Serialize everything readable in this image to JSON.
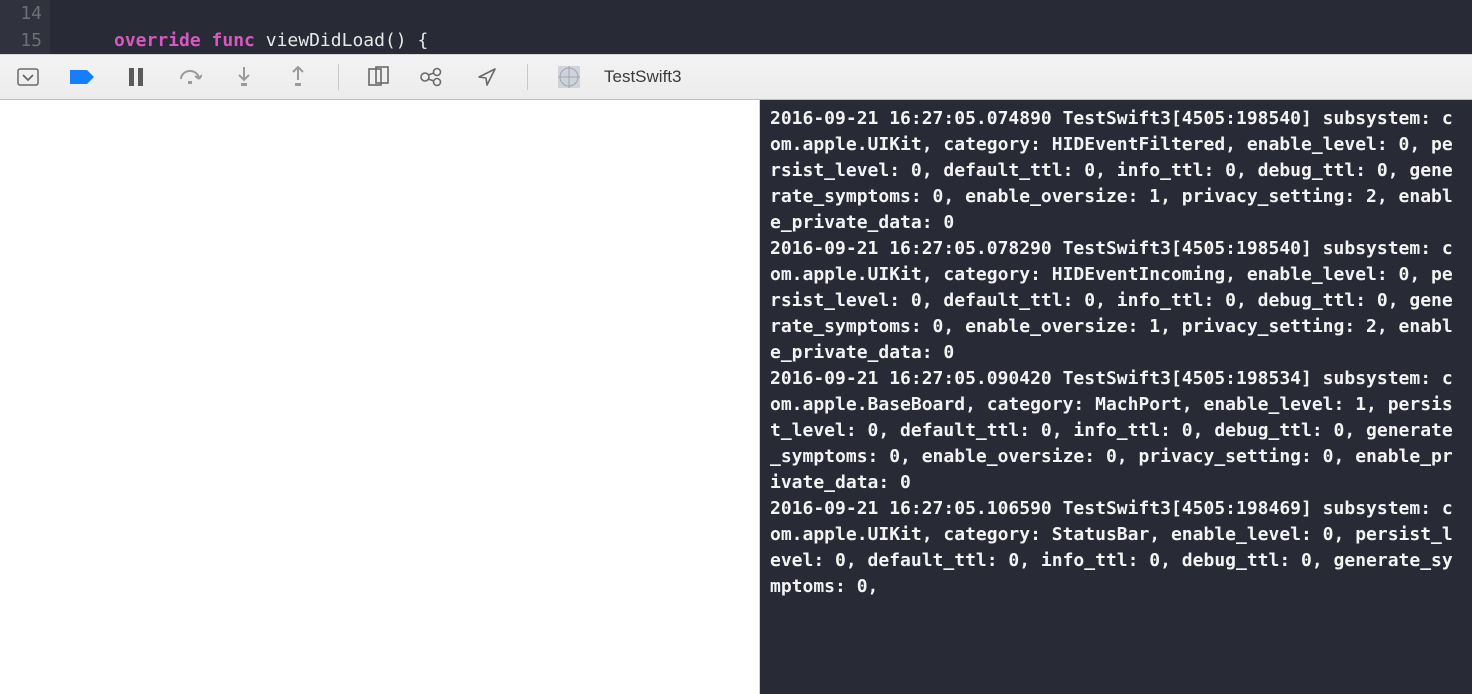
{
  "editor": {
    "lines": [
      {
        "num": "14",
        "tokens": []
      },
      {
        "num": "15",
        "tokens": [
          {
            "cls": "kw-override",
            "t": "override"
          },
          {
            "cls": "",
            "t": " "
          },
          {
            "cls": "kw-func",
            "t": "func"
          },
          {
            "cls": "",
            "t": " "
          },
          {
            "cls": "fn-name",
            "t": "viewDidLoad"
          },
          {
            "cls": "paren",
            "t": "() {"
          }
        ]
      }
    ]
  },
  "debugbar": {
    "scheme": "TestSwift3"
  },
  "console_lines": [
    "2016-09-21 16:27:05.074890 TestSwift3[4505:198540] subsystem: com.apple.UIKit, category: HIDEventFiltered, enable_level: 0, persist_level: 0, default_ttl: 0, info_ttl: 0, debug_ttl: 0, generate_symptoms: 0, enable_oversize: 1, privacy_setting: 2, enable_private_data: 0",
    "2016-09-21 16:27:05.078290 TestSwift3[4505:198540] subsystem: com.apple.UIKit, category: HIDEventIncoming, enable_level: 0, persist_level: 0, default_ttl: 0, info_ttl: 0, debug_ttl: 0, generate_symptoms: 0, enable_oversize: 1, privacy_setting: 2, enable_private_data: 0",
    "2016-09-21 16:27:05.090420 TestSwift3[4505:198534] subsystem: com.apple.BaseBoard, category: MachPort, enable_level: 1, persist_level: 0, default_ttl: 0, info_ttl: 0, debug_ttl: 0, generate_symptoms: 0, enable_oversize: 0, privacy_setting: 0, enable_private_data: 0",
    "2016-09-21 16:27:05.106590 TestSwift3[4505:198469] subsystem: com.apple.UIKit, category: StatusBar, enable_level: 0, persist_level: 0, default_ttl: 0, info_ttl: 0, debug_ttl: 0, generate_symptoms: 0,"
  ]
}
